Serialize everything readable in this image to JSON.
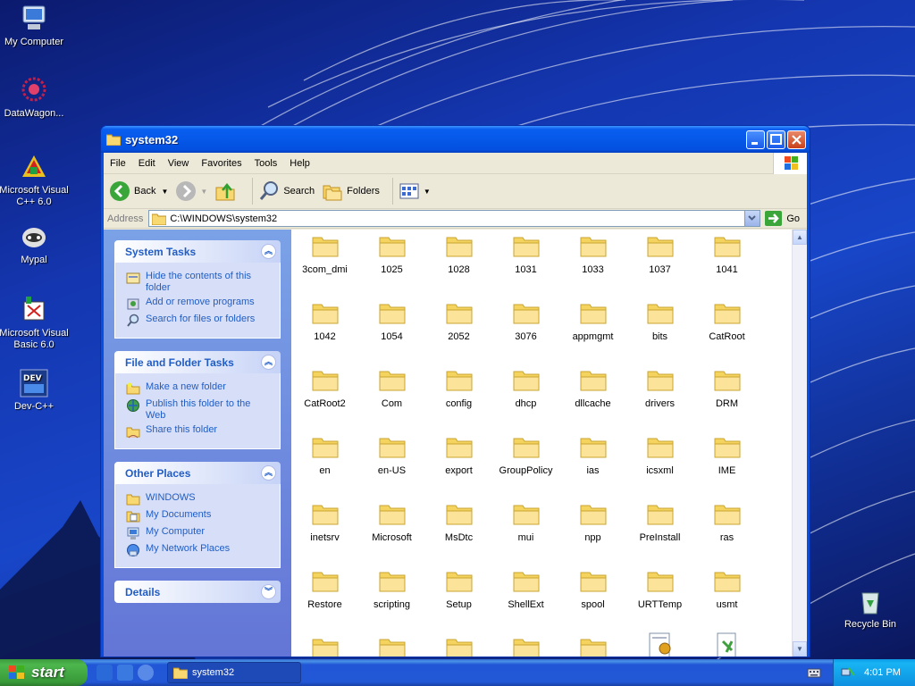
{
  "desktop": {
    "icons": [
      {
        "label": "My Computer",
        "icon": "my-computer-icon"
      },
      {
        "label": "DataWagon...",
        "icon": "datawagon-icon"
      },
      {
        "label": "Microsoft Visual C++ 6.0",
        "icon": "visual-cpp-icon"
      },
      {
        "label": "Mypal",
        "icon": "mypal-icon"
      },
      {
        "label": "Microsoft Visual Basic 6.0",
        "icon": "visual-basic-icon"
      },
      {
        "label": "Dev-C++",
        "icon": "dev-cpp-icon"
      },
      {
        "label": "Recycle Bin",
        "icon": "recycle-bin-icon"
      }
    ]
  },
  "window": {
    "title": "system32",
    "menu": [
      "File",
      "Edit",
      "View",
      "Favorites",
      "Tools",
      "Help"
    ],
    "toolbar": {
      "back": "Back",
      "search": "Search",
      "folders": "Folders"
    },
    "address": {
      "label": "Address",
      "value": "C:\\WINDOWS\\system32",
      "go": "Go"
    },
    "taskpane": {
      "system_tasks": {
        "title": "System Tasks",
        "items": [
          "Hide the contents of this folder",
          "Add or remove programs",
          "Search for files or folders"
        ]
      },
      "file_folder_tasks": {
        "title": "File and Folder Tasks",
        "items": [
          "Make a new folder",
          "Publish this folder to the Web",
          "Share this folder"
        ]
      },
      "other_places": {
        "title": "Other Places",
        "items": [
          "WINDOWS",
          "My Documents",
          "My Computer",
          "My Network Places"
        ]
      },
      "details": {
        "title": "Details"
      }
    },
    "files": [
      "3com_dmi",
      "1025",
      "1028",
      "1031",
      "1033",
      "1037",
      "1041",
      "1042",
      "1054",
      "2052",
      "3076",
      "appmgmt",
      "bits",
      "CatRoot",
      "CatRoot2",
      "Com",
      "config",
      "dhcp",
      "dllcache",
      "drivers",
      "DRM",
      "en",
      "en-US",
      "export",
      "GroupPolicy",
      "ias",
      "icsxml",
      "IME",
      "inetsrv",
      "Microsoft",
      "MsDtc",
      "mui",
      "npp",
      "PreInstall",
      "ras",
      "Restore",
      "scripting",
      "Setup",
      "ShellExt",
      "spool",
      "URTTemp",
      "usmt"
    ]
  },
  "taskbar": {
    "start": "start",
    "task": "system32",
    "clock": "4:01 PM"
  },
  "colors": {
    "link": "#215dc6",
    "titlebar": "#0558e8",
    "taskbar": "#2257d6",
    "start": "#389a38"
  }
}
